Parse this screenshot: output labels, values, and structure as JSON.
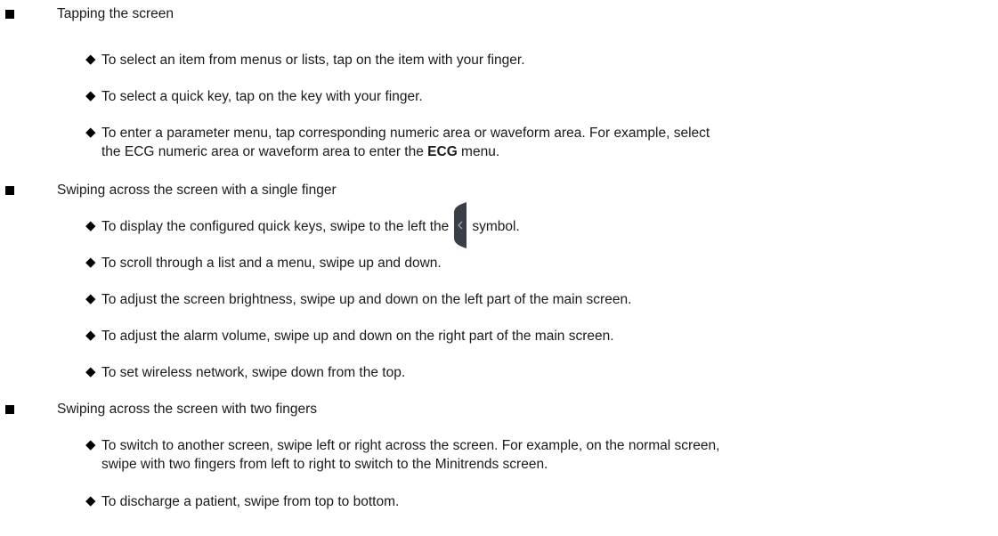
{
  "groups": [
    {
      "title": "Tapping the screen",
      "items": [
        "To select an item from menus or lists, tap on the item with your finger.",
        "To select a quick key, tap on the key with your finger."
      ],
      "item3": {
        "line1": "To enter a parameter menu, tap corresponding numeric area or waveform area. For example, select",
        "line2_pre": "the ECG numeric area or waveform area to enter the ",
        "line2_bold": "ECG",
        "line2_post": " menu."
      }
    },
    {
      "title": "Swiping across the screen with a single finger",
      "item1": {
        "pre": "To display the configured quick keys, swipe to the left  the",
        "post": "symbol."
      },
      "items": [
        "To scroll through a list and a menu, swipe up and down.",
        "To adjust the screen brightness, swipe up and down on the left part of the main screen.",
        "To adjust the alarm volume, swipe up and down on the right part of the main screen.",
        "To set wireless network, swipe down from the top."
      ]
    },
    {
      "title": "Swiping across the screen with two fingers",
      "item1": {
        "line1": "To switch to another screen, swipe left or right across the screen. For example, on the normal screen,",
        "line2": "swipe with two fingers from left to right to switch to the Minitrends screen."
      },
      "items": [
        "To discharge a patient, swipe from top to bottom."
      ]
    }
  ],
  "icons": {
    "handle": "quick-key-pull-tab-icon",
    "handle_color": "#3a3f47",
    "chevron_color": "#9aa0a6"
  }
}
